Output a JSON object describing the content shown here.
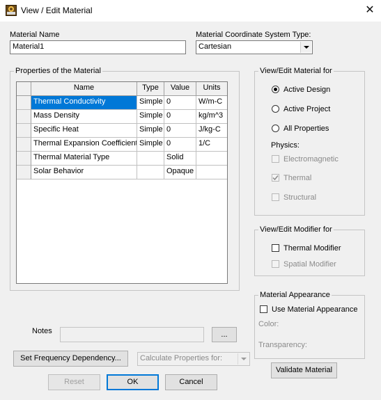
{
  "window": {
    "title": "View / Edit Material",
    "close_icon": "✕"
  },
  "material_name": {
    "label": "Material Name",
    "value": "Material1"
  },
  "coord_system": {
    "label": "Material Coordinate System Type:",
    "value": "Cartesian"
  },
  "properties": {
    "title": "Properties of the Material",
    "columns": [
      "Name",
      "Type",
      "Value",
      "Units"
    ],
    "rows": [
      {
        "name": "Thermal Conductivity",
        "type": "Simple",
        "value": "0",
        "units": "W/m-C"
      },
      {
        "name": "Mass Density",
        "type": "Simple",
        "value": "0",
        "units": "kg/m^3"
      },
      {
        "name": "Specific Heat",
        "type": "Simple",
        "value": "0",
        "units": "J/kg-C"
      },
      {
        "name": "Thermal Expansion Coefficient",
        "type": "Simple",
        "value": "0",
        "units": "1/C"
      },
      {
        "name": "Thermal Material Type",
        "type": "",
        "value": "Solid",
        "units": ""
      },
      {
        "name": "Solar Behavior",
        "type": "",
        "value": "Opaque",
        "units": ""
      }
    ]
  },
  "view_edit_for": {
    "title": "View/Edit Material for",
    "options": [
      "Active Design",
      "Active Project",
      "All Properties"
    ],
    "selected": "Active Design",
    "physics_label": "Physics:",
    "physics": [
      {
        "label": "Electromagnetic",
        "checked": false
      },
      {
        "label": "Thermal",
        "checked": true
      },
      {
        "label": "Structural",
        "checked": false
      }
    ]
  },
  "modifier_for": {
    "title": "View/Edit Modifier for",
    "thermal_modifier": "Thermal Modifier",
    "spatial_modifier": "Spatial Modifier"
  },
  "appearance": {
    "title": "Material Appearance",
    "use_label": "Use Material Appearance",
    "color_label": "Color:",
    "transparency_label": "Transparency:"
  },
  "notes": {
    "label": "Notes",
    "value": "",
    "browse": "..."
  },
  "buttons": {
    "set_frequency": "Set Frequency Dependency...",
    "calculate_for": "Calculate Properties for:",
    "reset": "Reset",
    "ok": "OK",
    "cancel": "Cancel",
    "validate": "Validate Material"
  },
  "colors": {
    "selection": "#0078d7",
    "window_bg": "#f0f0f0"
  }
}
